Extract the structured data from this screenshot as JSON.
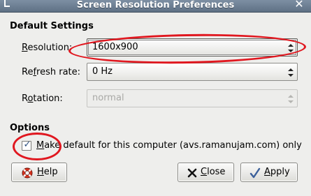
{
  "window": {
    "title": "Screen Resolution Preferences",
    "close_glyph": "✕"
  },
  "default_settings": {
    "heading": "Default Settings",
    "resolution": {
      "mnemonic": "R",
      "label_rest": "esolution:",
      "value": "1600x900"
    },
    "refresh_rate": {
      "label_pre": "Re",
      "mnemonic": "f",
      "label_rest": "resh rate:",
      "value": "0 Hz"
    },
    "rotation": {
      "label_pre": "R",
      "mnemonic": "o",
      "label_rest": "tation:",
      "value": "normal",
      "enabled": false
    }
  },
  "options": {
    "heading": "Options",
    "make_default": {
      "checked": true,
      "check_glyph": "✓",
      "mnemonic": "M",
      "label_rest": "ake default for this computer (avs.ramanujam.com) only"
    }
  },
  "buttons": {
    "help": {
      "mnemonic": "H",
      "label_rest": "elp",
      "icon": "lifebuoy-icon"
    },
    "close": {
      "mnemonic": "C",
      "label_rest": "lose",
      "icon": "close-x-icon"
    },
    "apply": {
      "mnemonic": "A",
      "label_rest": "pply",
      "icon": "checkmark-icon"
    }
  },
  "annotations": {
    "color": "#e0171f"
  }
}
